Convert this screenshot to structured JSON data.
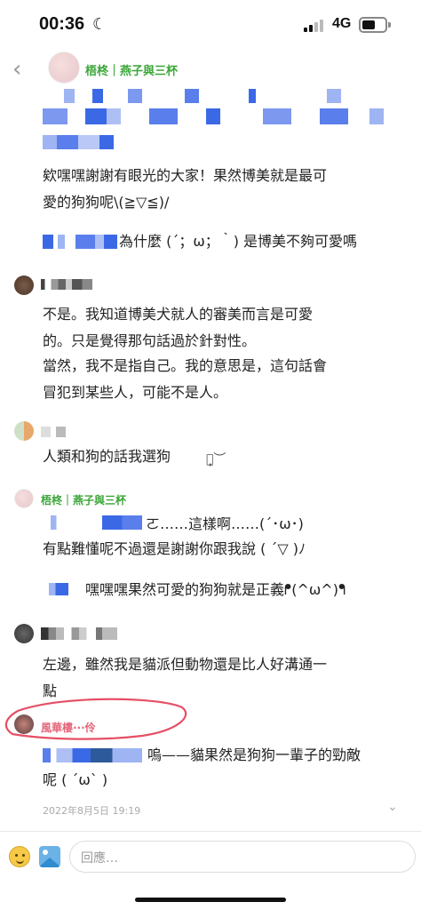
{
  "status_bar": {
    "time": "00:36",
    "network": "4G",
    "moon_icon": "☾"
  },
  "header": {
    "title": "梧柊｜燕子與三杯"
  },
  "messages": {
    "m1_line1": "欸嘿嘿謝謝有眼光的大家！果然博美就是最可",
    "m1_line2": "愛的狗狗呢\\(≧▽≦)/",
    "m1_quote": "為什麼 (´；ω；｀) 是博美不夠可愛嗎",
    "m2_line1": "不是。我知道博美犬就人的審美而言是可愛",
    "m2_line2": "的。只是覺得那句話過於針對性。",
    "m2_line3": "當然，我不是指自己。我的意思是，這句話會",
    "m2_line4": "冒犯到某些人，可能不是人。",
    "m3_line1": "人類和狗的話我選狗",
    "m4_name": "梧柊｜燕子與三杯",
    "m4_line1": "ㄛ……這樣啊……(´･ω･)",
    "m4_line2": "有點難懂呢不過還是謝謝你跟我說 ( ´▽ )ﾉ",
    "m4_line3": "嘿嘿嘿果然可愛的狗狗就是正義ᖰ(^ω^)ᖳ",
    "m5_line1": "左邊，雖然我是貓派但動物還是比人好溝通一",
    "m5_line2": "點",
    "m6_name": "風華樓···伶",
    "m6_line1": "嗚——貓果然是狗狗一輩子的勁敵",
    "m6_line2": "呢 ( ´ω` )"
  },
  "footer": {
    "date": "2022年8月5日 19:19",
    "reply_placeholder": "回應…"
  },
  "colors": {
    "green": "#3aa637",
    "pink": "#e4667a",
    "annotation_red": "#e0304a"
  }
}
